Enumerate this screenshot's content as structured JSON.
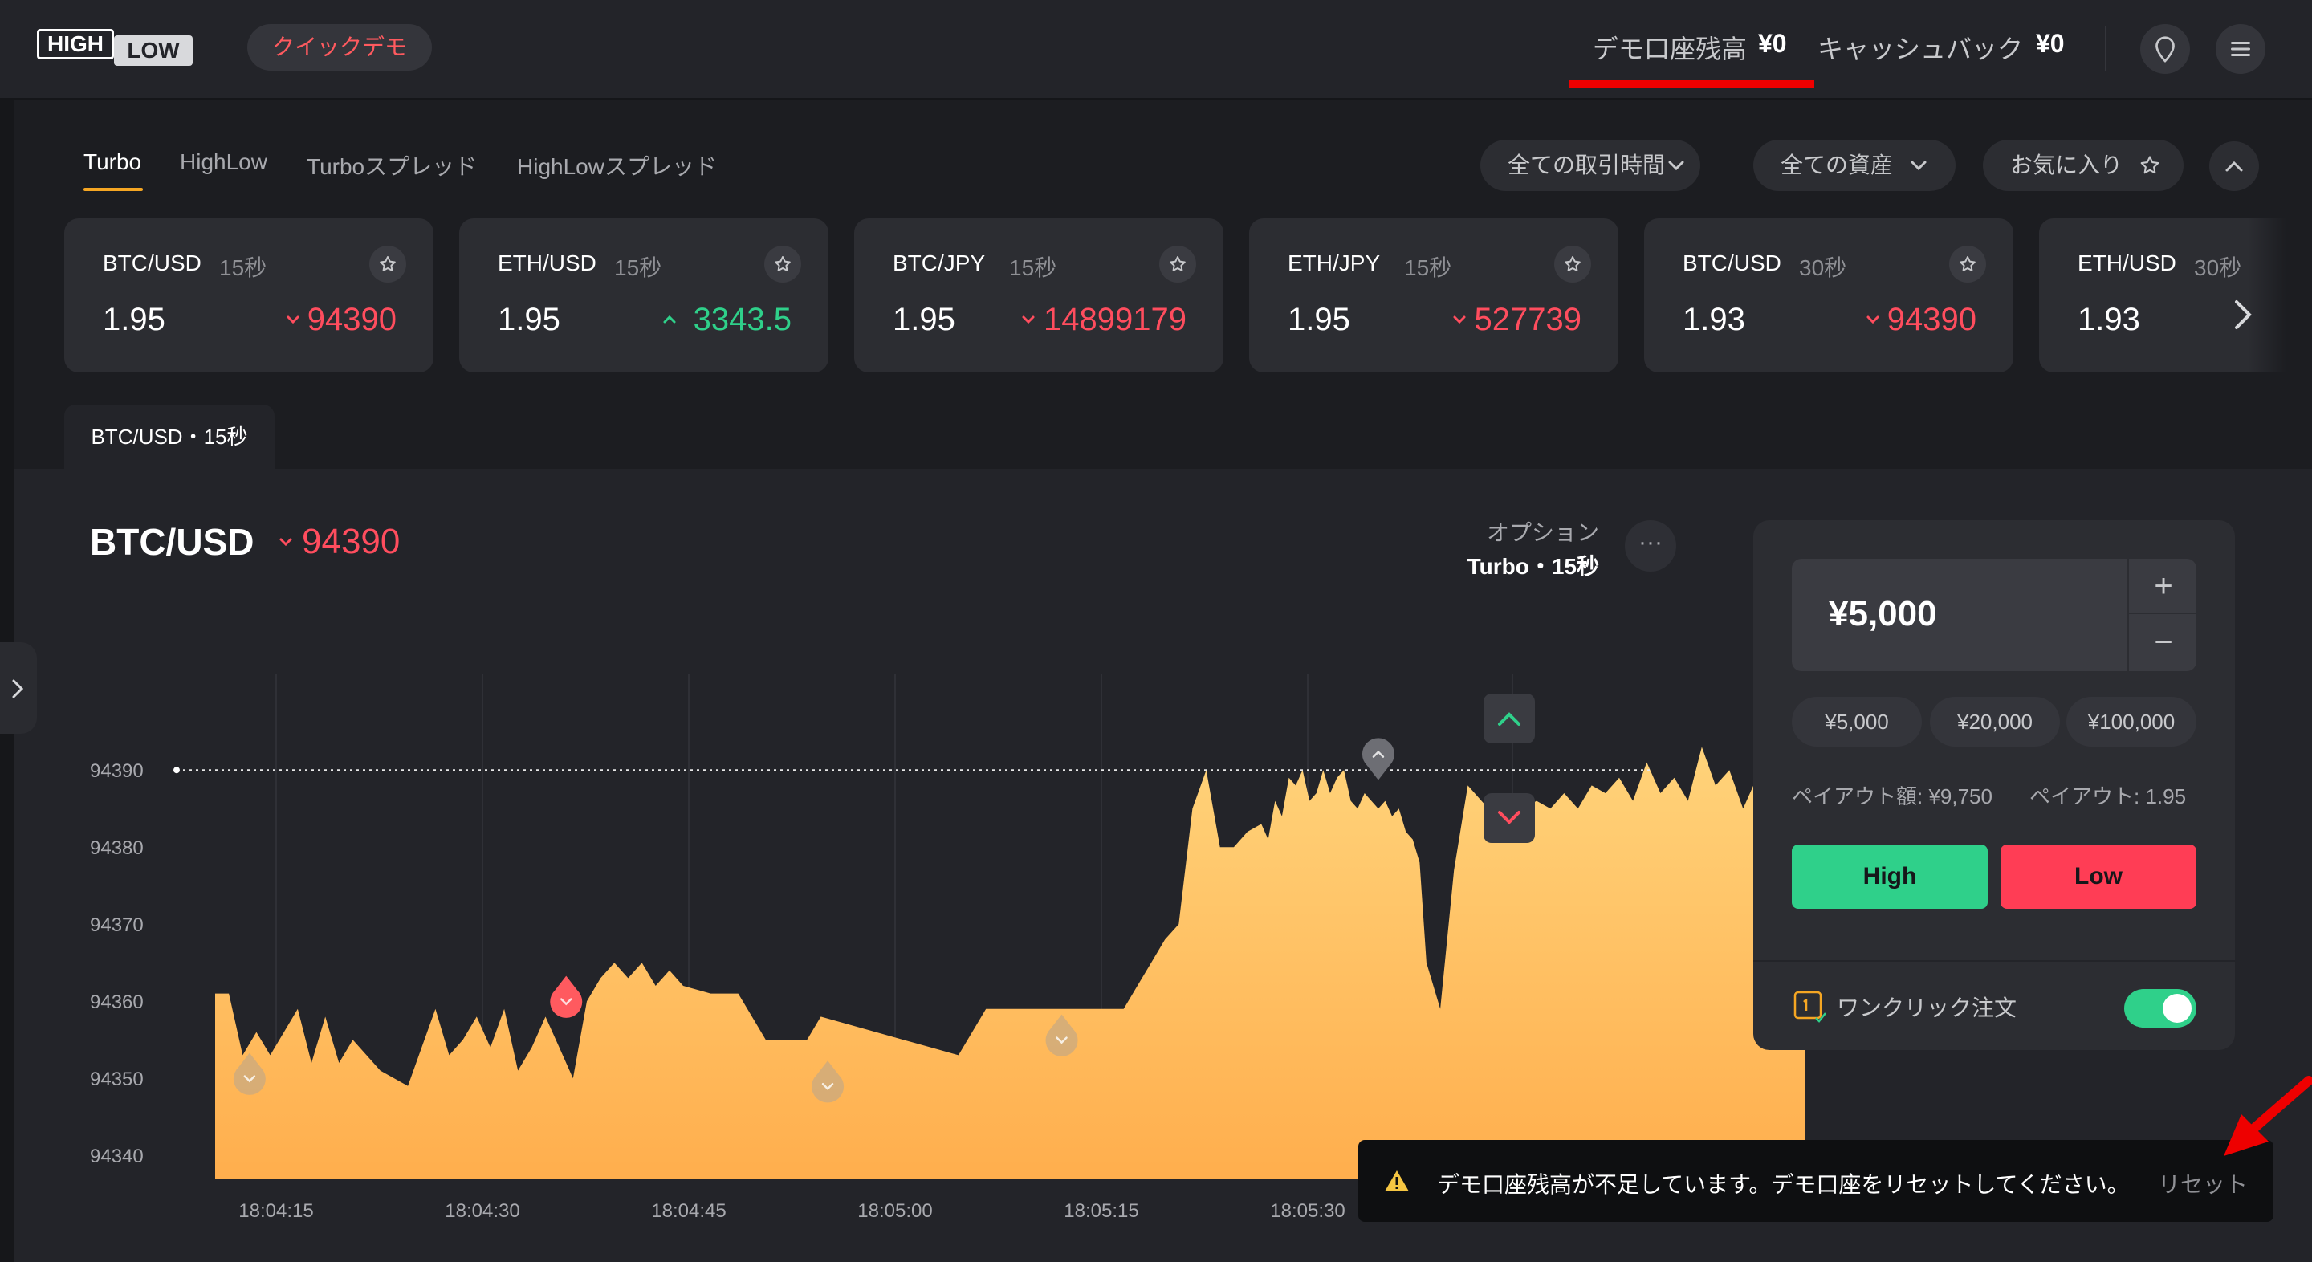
{
  "brand": {
    "logo_top": "HIGH",
    "logo_bottom": "LOW"
  },
  "header": {
    "quick_demo": "クイックデモ",
    "demo_balance_label": "デモ口座残高",
    "demo_balance_value": "¥0",
    "cashback_label": "キャッシュバック",
    "cashback_value": "¥0"
  },
  "icons": {
    "location": "map-pin-icon",
    "menu": "hamburger-menu-icon"
  },
  "tabs": [
    {
      "label": "Turbo",
      "active": true
    },
    {
      "label": "HighLow",
      "active": false
    },
    {
      "label": "Turboスプレッド",
      "active": false
    },
    {
      "label": "HighLowスプレッド",
      "active": false
    }
  ],
  "filters": {
    "trade_time": "全ての取引時間",
    "assets": "全ての資産",
    "favorites": "お気に入り"
  },
  "cards": [
    {
      "name": "BTC/USD",
      "duration": "15秒",
      "payout": "1.95",
      "price": "94390",
      "direction": "down"
    },
    {
      "name": "ETH/USD",
      "duration": "15秒",
      "payout": "1.95",
      "price": "3343.5",
      "direction": "up"
    },
    {
      "name": "BTC/JPY",
      "duration": "15秒",
      "payout": "1.95",
      "price": "14899179",
      "direction": "down"
    },
    {
      "name": "ETH/JPY",
      "duration": "15秒",
      "payout": "1.95",
      "price": "527739",
      "direction": "down"
    },
    {
      "name": "BTC/USD",
      "duration": "30秒",
      "payout": "1.93",
      "price": "94390",
      "direction": "down"
    },
    {
      "name": "ETH/USD",
      "duration": "30秒",
      "payout": "1.93",
      "price": "",
      "direction": ""
    }
  ],
  "chart_tab": "BTC/USD・15秒",
  "chart_header": {
    "symbol": "BTC/USD",
    "price": "94390",
    "option_label": "オプション",
    "option_value": "Turbo・15秒",
    "more": "···"
  },
  "chart_data": {
    "type": "area",
    "x_ticks": [
      "18:04:15",
      "18:04:30",
      "18:04:45",
      "18:05:00",
      "18:05:15",
      "18:05:30"
    ],
    "y_ticks": [
      94390,
      94380,
      94370,
      94360,
      94350,
      94340
    ],
    "ylim": [
      94337,
      94392
    ],
    "current_price": 94390,
    "color": "#ffc968",
    "grid": true,
    "t_seconds": [
      8,
      9,
      10,
      11,
      12,
      14,
      15,
      16,
      17,
      18,
      20,
      22,
      24,
      25,
      26,
      27,
      28,
      29,
      30,
      31,
      32,
      33,
      34,
      35,
      36,
      37,
      38,
      39,
      40,
      41,
      42,
      44,
      46,
      48,
      49,
      50,
      51,
      52,
      54,
      56,
      58,
      60,
      62,
      64,
      66,
      68,
      70,
      72,
      74,
      75,
      76,
      77,
      78,
      79,
      80,
      81,
      82,
      83,
      84,
      84.5,
      85,
      85.5,
      86,
      86.5,
      87,
      87.5,
      88,
      88.5,
      89,
      89.5,
      90,
      90.5,
      91,
      91.5,
      92,
      92.5,
      93,
      93.5,
      94,
      94.5,
      95,
      95.5,
      96,
      97,
      98,
      99,
      100,
      101,
      102,
      103,
      104,
      105,
      106,
      107,
      108,
      109,
      110,
      111,
      112,
      113,
      114,
      115,
      116,
      117,
      118,
      119,
      120,
      121,
      122,
      123,
      123.5
    ],
    "values": [
      94361,
      94361,
      94353,
      94356,
      94353,
      94359,
      94352,
      94358,
      94352,
      94355,
      94351,
      94349,
      94359,
      94353,
      94355,
      94358,
      94354,
      94359,
      94351,
      94354,
      94358,
      94354,
      94350,
      94360,
      94363,
      94365,
      94363,
      94365,
      94362,
      94364,
      94362,
      94361,
      94361,
      94355,
      94355,
      94355,
      94355,
      94358,
      94357,
      94356,
      94355,
      94354,
      94353,
      94359,
      94359,
      94359,
      94359,
      94359,
      94359,
      94362,
      94365,
      94368,
      94370,
      94385,
      94390,
      94380,
      94380,
      94382,
      94383,
      94381,
      94386,
      94384,
      94389,
      94388,
      94390,
      94386,
      94387,
      94390,
      94387,
      94389,
      94390,
      94386,
      94385,
      94387,
      94386,
      94385,
      94386,
      94384,
      94385,
      94382,
      94381,
      94378,
      94365,
      94359,
      94377,
      94388,
      94386,
      94384,
      94386,
      94385,
      94386,
      94385,
      94387,
      94385,
      94388,
      94387,
      94389,
      94386,
      94391,
      94387,
      94389,
      94386,
      94393,
      94388,
      94390,
      94385,
      94389,
      94387,
      94392,
      94386,
      94390
    ],
    "markers": [
      {
        "t": 10.5,
        "v": 94351,
        "direction": "down",
        "state": "faded"
      },
      {
        "t": 33.5,
        "v": 94361,
        "direction": "down",
        "state": "active"
      },
      {
        "t": 52.5,
        "v": 94350,
        "direction": "down",
        "state": "faded"
      },
      {
        "t": 69.5,
        "v": 94356,
        "direction": "down",
        "state": "faded"
      },
      {
        "t": 92.5,
        "v": 94391,
        "direction": "up",
        "state": "neutral"
      }
    ]
  },
  "trade_panel": {
    "amount": "¥5,000",
    "plus": "+",
    "minus": "−",
    "presets": [
      "¥5,000",
      "¥20,000",
      "¥100,000"
    ],
    "payout_amount": "ペイアウト額: ¥9,750",
    "payout_rate": "ペイアウト: 1.95",
    "high": "High",
    "low": "Low",
    "one_click_label": "ワンクリック注文",
    "one_click_on": true
  },
  "toast": {
    "message": "デモ口座残高が不足しています。デモ口座をリセットしてください。",
    "action": "リセット"
  },
  "colors": {
    "up": "#2fd08a",
    "down": "#ff4d5e",
    "accent": "#f5a623",
    "annotation": "#ee0000"
  }
}
